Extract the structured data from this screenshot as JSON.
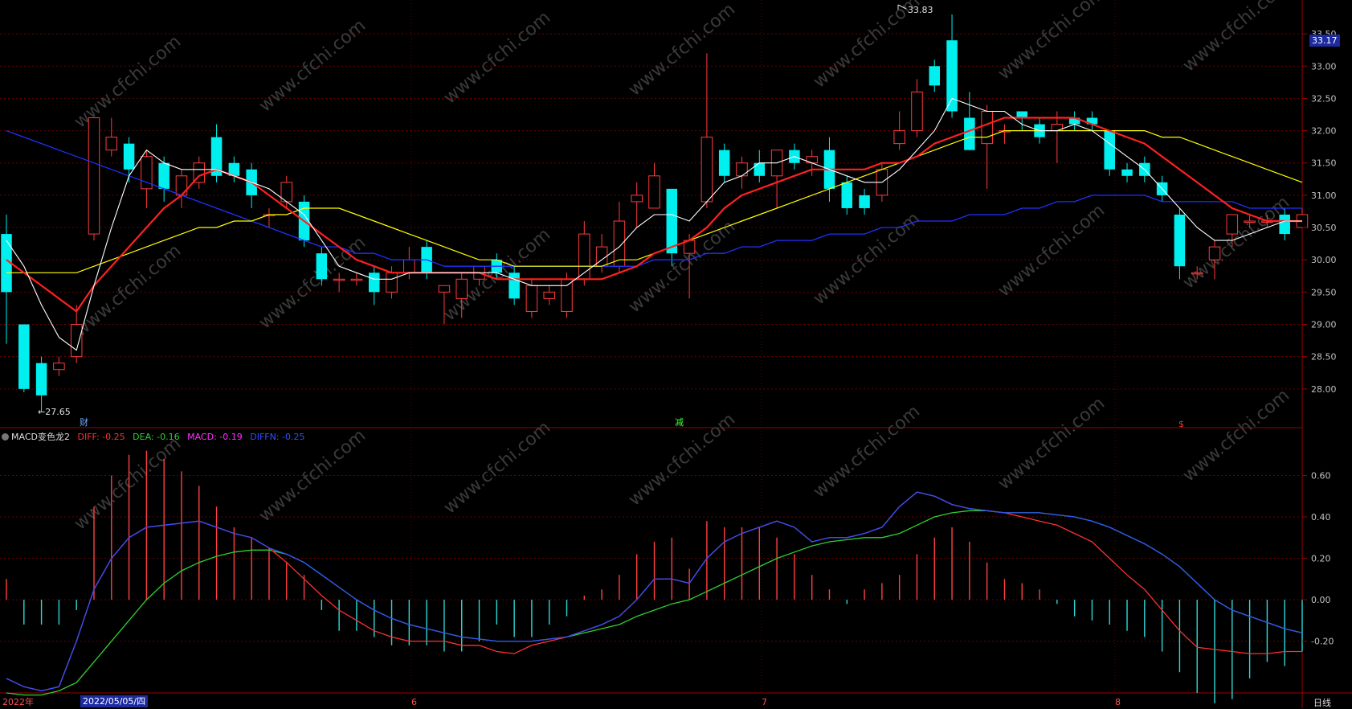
{
  "indicator_header": {
    "name": "MACD变色龙2",
    "diff": "DIFF: -0.25",
    "dea": "DEA: -0.16",
    "macd": "MACD: -0.19",
    "diffn": "DIFFN: -0.25",
    "colors": {
      "diff": "#ff3030",
      "dea": "#30d030",
      "macd": "#ff30ff",
      "diffn": "#3040ff"
    }
  },
  "markers": {
    "high_label": "33.83",
    "low_label": "←27.65",
    "event1": "财",
    "event2": "减",
    "event3": "$"
  },
  "x_axis": {
    "year_label": "2022年",
    "cursor_date": "2022/05/05/四",
    "months": [
      "6",
      "7",
      "8"
    ]
  },
  "price_box": "33.17",
  "timeframe": "日线",
  "watermark": "www.cfchi.com",
  "colors": {
    "up": "#ff3b3b",
    "down": "#00f0f0",
    "ma5": "#ffffff",
    "ma10": "#ff2020",
    "ma20": "#ffff00",
    "ma60": "#2030ff",
    "grid": "#6a0000"
  },
  "chart_data": [
    {
      "type": "candlestick",
      "title": "",
      "ylim": [
        27.4,
        33.9
      ],
      "y_ticks": [
        "28.00",
        "28.50",
        "29.00",
        "29.50",
        "30.00",
        "30.50",
        "31.00",
        "31.50",
        "32.00",
        "32.50",
        "33.00",
        "33.50"
      ],
      "candles": [
        [
          30.4,
          29.5,
          30.7,
          28.7
        ],
        [
          29.0,
          28.0,
          29.0,
          27.95
        ],
        [
          28.4,
          27.9,
          28.5,
          27.65
        ],
        [
          28.3,
          28.4,
          28.5,
          28.2
        ],
        [
          28.5,
          29.0,
          29.3,
          28.4
        ],
        [
          30.4,
          32.2,
          32.2,
          30.3
        ],
        [
          31.7,
          31.9,
          32.2,
          31.6
        ],
        [
          31.8,
          31.4,
          31.9,
          31.2
        ],
        [
          31.1,
          31.6,
          31.7,
          30.8
        ],
        [
          31.5,
          31.1,
          31.6,
          30.9
        ],
        [
          31.0,
          31.3,
          31.4,
          30.8
        ],
        [
          31.2,
          31.5,
          31.6,
          31.1
        ],
        [
          31.9,
          31.3,
          32.1,
          31.2
        ],
        [
          31.5,
          31.3,
          31.6,
          31.2
        ],
        [
          31.4,
          31.0,
          31.5,
          30.8
        ],
        [
          30.7,
          30.7,
          30.8,
          30.5
        ],
        [
          30.9,
          31.2,
          31.3,
          30.8
        ],
        [
          30.9,
          30.3,
          31.0,
          30.2
        ],
        [
          30.1,
          29.7,
          30.2,
          29.6
        ],
        [
          29.7,
          29.7,
          29.8,
          29.5
        ],
        [
          29.7,
          29.7,
          29.8,
          29.6
        ],
        [
          29.8,
          29.5,
          29.9,
          29.3
        ],
        [
          29.5,
          29.8,
          29.9,
          29.4
        ],
        [
          29.8,
          30.0,
          30.2,
          29.7
        ],
        [
          30.2,
          29.8,
          30.3,
          29.7
        ],
        [
          29.5,
          29.6,
          29.6,
          29.0
        ],
        [
          29.4,
          29.7,
          29.8,
          29.1
        ],
        [
          29.7,
          29.9,
          29.9,
          29.6
        ],
        [
          30.0,
          29.8,
          30.1,
          29.7
        ],
        [
          29.8,
          29.4,
          29.9,
          29.3
        ],
        [
          29.2,
          29.6,
          29.7,
          29.1
        ],
        [
          29.4,
          29.5,
          29.6,
          29.3
        ],
        [
          29.2,
          29.7,
          29.8,
          29.1
        ],
        [
          29.7,
          30.4,
          30.6,
          29.6
        ],
        [
          29.9,
          30.2,
          30.4,
          29.8
        ],
        [
          29.9,
          30.6,
          30.9,
          29.8
        ],
        [
          30.9,
          31.0,
          31.2,
          30.5
        ],
        [
          30.8,
          31.3,
          31.5,
          30.8
        ],
        [
          31.1,
          30.1,
          31.1,
          29.9
        ],
        [
          30.1,
          30.3,
          30.4,
          29.4
        ],
        [
          30.9,
          31.9,
          33.2,
          30.8
        ],
        [
          31.7,
          31.3,
          31.8,
          31.2
        ],
        [
          31.3,
          31.5,
          31.6,
          31.1
        ],
        [
          31.5,
          31.3,
          31.7,
          31.2
        ],
        [
          31.3,
          31.7,
          31.7,
          30.8
        ],
        [
          31.7,
          31.5,
          31.8,
          31.4
        ],
        [
          31.5,
          31.6,
          31.7,
          31.3
        ],
        [
          31.7,
          31.1,
          31.9,
          30.9
        ],
        [
          31.2,
          30.8,
          31.3,
          30.7
        ],
        [
          31.0,
          30.8,
          31.1,
          30.7
        ],
        [
          31.0,
          31.4,
          31.5,
          30.9
        ],
        [
          31.8,
          32.0,
          32.3,
          31.7
        ],
        [
          32.0,
          32.6,
          32.8,
          31.9
        ],
        [
          33.0,
          32.7,
          33.1,
          32.6
        ],
        [
          33.4,
          32.3,
          33.8,
          32.2
        ],
        [
          32.2,
          31.7,
          32.6,
          31.7
        ],
        [
          31.8,
          32.3,
          32.4,
          31.1
        ],
        [
          32.0,
          32.0,
          32.1,
          31.8
        ],
        [
          32.3,
          32.2,
          32.3,
          32.0
        ],
        [
          32.1,
          31.9,
          32.2,
          31.8
        ],
        [
          32.0,
          32.1,
          32.3,
          31.5
        ],
        [
          32.2,
          32.1,
          32.3,
          32.0
        ],
        [
          32.2,
          32.1,
          32.3,
          32.0
        ],
        [
          32.0,
          31.4,
          32.0,
          31.3
        ],
        [
          31.4,
          31.3,
          31.5,
          31.2
        ],
        [
          31.5,
          31.3,
          31.6,
          31.2
        ],
        [
          31.2,
          31.0,
          31.3,
          30.9
        ],
        [
          30.7,
          29.9,
          30.8,
          29.7
        ],
        [
          29.8,
          29.8,
          29.9,
          29.7
        ],
        [
          30.0,
          30.2,
          30.3,
          29.7
        ],
        [
          30.4,
          30.7,
          30.7,
          30.2
        ],
        [
          30.6,
          30.6,
          30.7,
          30.5
        ],
        [
          30.6,
          30.6,
          30.7,
          30.5
        ],
        [
          30.7,
          30.4,
          30.8,
          30.3
        ],
        [
          30.5,
          30.7,
          30.8,
          30.5
        ]
      ],
      "ma5": [
        30.3,
        29.9,
        29.3,
        28.8,
        28.6,
        29.6,
        30.5,
        31.3,
        31.7,
        31.5,
        31.4,
        31.4,
        31.4,
        31.3,
        31.2,
        31.1,
        30.9,
        30.7,
        30.3,
        29.9,
        29.8,
        29.7,
        29.7,
        29.8,
        29.8,
        29.8,
        29.8,
        29.8,
        29.8,
        29.7,
        29.6,
        29.6,
        29.6,
        29.8,
        30.0,
        30.2,
        30.5,
        30.7,
        30.7,
        30.6,
        30.9,
        31.2,
        31.3,
        31.5,
        31.5,
        31.6,
        31.5,
        31.4,
        31.3,
        31.2,
        31.2,
        31.4,
        31.7,
        32.0,
        32.5,
        32.4,
        32.3,
        32.3,
        32.1,
        32.0,
        32.0,
        32.1,
        32.0,
        31.8,
        31.6,
        31.4,
        31.1,
        30.8,
        30.5,
        30.3,
        30.3,
        30.4,
        30.5,
        30.6,
        30.6
      ],
      "ma10": [
        30.0,
        29.8,
        29.6,
        29.4,
        29.2,
        29.6,
        29.9,
        30.2,
        30.5,
        30.8,
        31.0,
        31.3,
        31.4,
        31.3,
        31.2,
        31.0,
        30.8,
        30.6,
        30.4,
        30.2,
        30.0,
        29.9,
        29.8,
        29.8,
        29.8,
        29.8,
        29.8,
        29.8,
        29.7,
        29.7,
        29.7,
        29.7,
        29.7,
        29.7,
        29.7,
        29.8,
        29.9,
        30.1,
        30.2,
        30.3,
        30.5,
        30.8,
        31.0,
        31.1,
        31.2,
        31.3,
        31.4,
        31.4,
        31.4,
        31.4,
        31.5,
        31.5,
        31.6,
        31.8,
        31.9,
        32.0,
        32.1,
        32.2,
        32.2,
        32.2,
        32.2,
        32.2,
        32.1,
        32.0,
        31.9,
        31.8,
        31.6,
        31.4,
        31.2,
        31.0,
        30.8,
        30.7,
        30.6,
        30.6,
        30.6
      ],
      "ma20": [
        29.8,
        29.8,
        29.8,
        29.8,
        29.8,
        29.9,
        30.0,
        30.1,
        30.2,
        30.3,
        30.4,
        30.5,
        30.5,
        30.6,
        30.6,
        30.7,
        30.7,
        30.8,
        30.8,
        30.8,
        30.7,
        30.6,
        30.5,
        30.4,
        30.3,
        30.2,
        30.1,
        30.0,
        30.0,
        29.9,
        29.9,
        29.9,
        29.9,
        29.9,
        29.9,
        30.0,
        30.0,
        30.1,
        30.2,
        30.3,
        30.4,
        30.5,
        30.6,
        30.7,
        30.8,
        30.9,
        31.0,
        31.1,
        31.2,
        31.3,
        31.4,
        31.5,
        31.6,
        31.7,
        31.8,
        31.9,
        31.9,
        32.0,
        32.0,
        32.0,
        32.0,
        32.0,
        32.0,
        32.0,
        32.0,
        32.0,
        31.9,
        31.9,
        31.8,
        31.7,
        31.6,
        31.5,
        31.4,
        31.3,
        31.2
      ],
      "ma60": [
        32.0,
        31.9,
        31.8,
        31.7,
        31.6,
        31.5,
        31.4,
        31.3,
        31.2,
        31.1,
        31.0,
        30.9,
        30.8,
        30.7,
        30.6,
        30.5,
        30.4,
        30.3,
        30.2,
        30.2,
        30.1,
        30.1,
        30.0,
        30.0,
        30.0,
        29.9,
        29.9,
        29.9,
        29.9,
        29.9,
        29.9,
        29.9,
        29.9,
        29.9,
        29.9,
        29.9,
        29.9,
        30.0,
        30.0,
        30.0,
        30.1,
        30.1,
        30.2,
        30.2,
        30.3,
        30.3,
        30.3,
        30.4,
        30.4,
        30.4,
        30.5,
        30.5,
        30.6,
        30.6,
        30.6,
        30.7,
        30.7,
        30.7,
        30.8,
        30.8,
        30.9,
        30.9,
        31.0,
        31.0,
        31.0,
        31.0,
        30.9,
        30.9,
        30.9,
        30.9,
        30.9,
        30.8,
        30.8,
        30.8,
        30.8
      ]
    },
    {
      "type": "bar+line",
      "title": "MACD变色龙2",
      "ylim": [
        -0.45,
        0.8
      ],
      "y_ticks": [
        "-0.20",
        "0.00",
        "0.20",
        "0.40",
        "0.60"
      ],
      "macd": [
        0.1,
        -0.12,
        -0.12,
        -0.12,
        -0.05,
        0.45,
        0.6,
        0.7,
        0.72,
        0.68,
        0.62,
        0.55,
        0.45,
        0.35,
        0.3,
        0.25,
        0.18,
        0.12,
        -0.05,
        -0.15,
        -0.15,
        -0.18,
        -0.22,
        -0.22,
        -0.22,
        -0.25,
        -0.25,
        -0.2,
        -0.12,
        -0.18,
        -0.18,
        -0.12,
        -0.08,
        0.02,
        0.05,
        0.12,
        0.22,
        0.28,
        0.3,
        0.15,
        0.38,
        0.35,
        0.35,
        0.35,
        0.3,
        0.22,
        0.12,
        0.05,
        -0.02,
        0.05,
        0.08,
        0.12,
        0.22,
        0.3,
        0.35,
        0.28,
        0.18,
        0.1,
        0.08,
        0.05,
        -0.02,
        -0.08,
        -0.1,
        -0.12,
        -0.15,
        -0.18,
        -0.25,
        -0.35,
        -0.45,
        -0.5,
        -0.48,
        -0.38,
        -0.3,
        -0.32,
        -0.25
      ],
      "diff": [
        -0.38,
        -0.42,
        -0.44,
        -0.42,
        -0.2,
        0.05,
        0.2,
        0.3,
        0.35,
        0.36,
        0.37,
        0.38,
        0.35,
        0.32,
        0.3,
        0.25,
        0.18,
        0.1,
        0.02,
        -0.05,
        -0.1,
        -0.15,
        -0.18,
        -0.2,
        -0.2,
        -0.2,
        -0.22,
        -0.22,
        -0.25,
        -0.26,
        -0.22,
        -0.2,
        -0.18,
        -0.15,
        -0.12,
        -0.08,
        0.0,
        0.1,
        0.1,
        0.08,
        0.2,
        0.28,
        0.32,
        0.35,
        0.38,
        0.35,
        0.28,
        0.3,
        0.3,
        0.32,
        0.35,
        0.45,
        0.52,
        0.5,
        0.46,
        0.44,
        0.43,
        0.42,
        0.4,
        0.38,
        0.36,
        0.32,
        0.28,
        0.2,
        0.12,
        0.05,
        -0.05,
        -0.15,
        -0.23,
        -0.24,
        -0.25,
        -0.26,
        -0.26,
        -0.25,
        -0.25
      ],
      "dea": [
        -0.45,
        -0.46,
        -0.46,
        -0.44,
        -0.4,
        -0.3,
        -0.2,
        -0.1,
        0.0,
        0.08,
        0.14,
        0.18,
        0.21,
        0.23,
        0.24,
        0.24,
        0.22,
        0.18,
        0.12,
        0.06,
        0.0,
        -0.05,
        -0.09,
        -0.12,
        -0.14,
        -0.16,
        -0.18,
        -0.19,
        -0.2,
        -0.2,
        -0.2,
        -0.19,
        -0.18,
        -0.16,
        -0.14,
        -0.12,
        -0.08,
        -0.05,
        -0.02,
        0.0,
        0.04,
        0.08,
        0.12,
        0.16,
        0.2,
        0.23,
        0.26,
        0.28,
        0.29,
        0.3,
        0.3,
        0.32,
        0.36,
        0.4,
        0.42,
        0.43,
        0.43,
        0.42,
        0.42,
        0.42,
        0.41,
        0.4,
        0.38,
        0.35,
        0.31,
        0.27,
        0.22,
        0.16,
        0.08,
        0.0,
        -0.05,
        -0.08,
        -0.11,
        -0.14,
        -0.16
      ]
    }
  ]
}
